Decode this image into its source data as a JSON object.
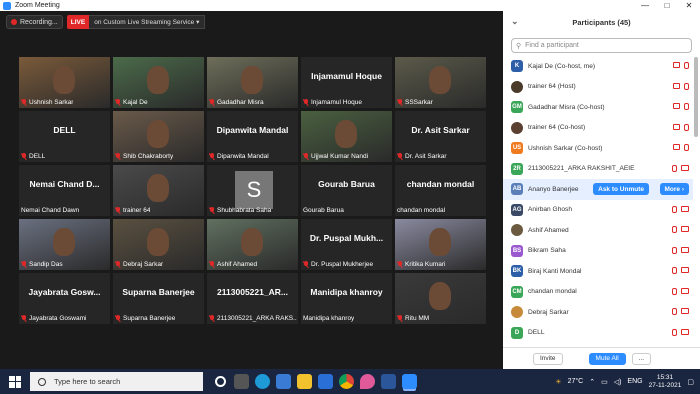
{
  "window": {
    "title": "Zoom Meeting",
    "min": "—",
    "max": "□",
    "close": "✕"
  },
  "topbar": {
    "recording": "Recording...",
    "live_tag": "LIVE",
    "live_service": "on Custom Live Streaming Service",
    "caret": "▾"
  },
  "tiles": [
    {
      "name": "Ushnish Sarkar",
      "big": "",
      "muted": true,
      "type": "video"
    },
    {
      "name": "Kajal De",
      "big": "",
      "muted": true,
      "type": "video"
    },
    {
      "name": "Gadadhar Misra",
      "big": "",
      "muted": true,
      "type": "video",
      "active": true
    },
    {
      "name": "Injamamul Hoque",
      "big": "Injamamul Hoque",
      "muted": true,
      "type": "name"
    },
    {
      "name": "SSSarkar",
      "big": "",
      "muted": true,
      "type": "video"
    },
    {
      "name": "DELL",
      "big": "DELL",
      "muted": true,
      "type": "name"
    },
    {
      "name": "Shib Chakraborty",
      "big": "",
      "muted": true,
      "type": "video"
    },
    {
      "name": "Dipanwita Mandal",
      "big": "Dipanwita Mandal",
      "muted": true,
      "type": "name"
    },
    {
      "name": "Ujjwal Kumar Nandi",
      "big": "",
      "muted": true,
      "type": "video"
    },
    {
      "name": "Dr. Asit Sarkar",
      "big": "Dr. Asit Sarkar",
      "muted": true,
      "type": "name"
    },
    {
      "name": "Nemai Chand Dawn",
      "big": "Nemai Chand D...",
      "muted": false,
      "type": "name"
    },
    {
      "name": "trainer 64",
      "big": "",
      "muted": true,
      "type": "video"
    },
    {
      "name": "Shubhabrata Saha",
      "big": "",
      "muted": true,
      "type": "avatar",
      "avatar": "S"
    },
    {
      "name": "Gourab Barua",
      "big": "Gourab Barua",
      "muted": false,
      "type": "name"
    },
    {
      "name": "chandan mondal",
      "big": "chandan mondal",
      "muted": false,
      "type": "name"
    },
    {
      "name": "Sandip Das",
      "big": "",
      "muted": true,
      "type": "video"
    },
    {
      "name": "Debraj Sarkar",
      "big": "",
      "muted": true,
      "type": "video"
    },
    {
      "name": "Ashif Ahamed",
      "big": "",
      "muted": true,
      "type": "video"
    },
    {
      "name": "Dr. Puspal Mukherjee",
      "big": "Dr. Puspal Mukh...",
      "muted": true,
      "type": "name"
    },
    {
      "name": "Kritika Kumari",
      "big": "",
      "muted": true,
      "type": "video"
    },
    {
      "name": "Jayabrata Goswami",
      "big": "Jayabrata Gosw...",
      "muted": true,
      "type": "name"
    },
    {
      "name": "Suparna Banerjee",
      "big": "Suparna Banerjee",
      "muted": true,
      "type": "name"
    },
    {
      "name": "2113005221_ARKA RAKS...",
      "big": "2113005221_AR...",
      "muted": true,
      "type": "name"
    },
    {
      "name": "Manidipa khanroy",
      "big": "Manidipa khanroy",
      "muted": false,
      "type": "name"
    },
    {
      "name": "Ritu MM",
      "big": "",
      "muted": true,
      "type": "video"
    }
  ],
  "participants": {
    "title": "Participants (45)",
    "search_placeholder": "Find a participant",
    "list": [
      {
        "label": "Kajal De (Co-host, me)",
        "avatar": "K",
        "color": "#2d5fa8",
        "photo": false
      },
      {
        "label": "trainer 64 (Host)",
        "avatar": "",
        "color": "#4a3a2a",
        "photo": true
      },
      {
        "label": "Gadadhar Misra (Co-host)",
        "avatar": "GM",
        "color": "#3aa657",
        "photo": false
      },
      {
        "label": "trainer 64 (Co-host)",
        "avatar": "",
        "color": "#5a4030",
        "photo": true
      },
      {
        "label": "Ushnish Sarkar (Co-host)",
        "avatar": "US",
        "color": "#f07a1e",
        "photo": false
      },
      {
        "label": "2113005221_ARKA RAKSHIT_AEIE",
        "avatar": "2R",
        "color": "#3aa657",
        "photo": false
      },
      {
        "label": "Ananyo Banerjee",
        "avatar": "AB",
        "color": "#5b7fb8",
        "photo": false,
        "highlight": true
      },
      {
        "label": "Anirban Ghosh",
        "avatar": "AG",
        "color": "#3a4a66",
        "photo": false
      },
      {
        "label": "Ashif Ahamed",
        "avatar": "",
        "color": "#6b5a40",
        "photo": true
      },
      {
        "label": "Bikram Saha",
        "avatar": "BS",
        "color": "#9b59d0",
        "photo": false
      },
      {
        "label": "Biraj Kanti Mondal",
        "avatar": "BK",
        "color": "#2d5fa8",
        "photo": false
      },
      {
        "label": "chandan mondal",
        "avatar": "CM",
        "color": "#3aa657",
        "photo": false
      },
      {
        "label": "Debraj Sarkar",
        "avatar": "",
        "color": "#c78a3a",
        "photo": true
      },
      {
        "label": "DELL",
        "avatar": "D",
        "color": "#3aa657",
        "photo": false
      }
    ],
    "ask_to_unmute": "Ask to Unmute",
    "more": "More ›",
    "invite": "Invite",
    "mute_all": "Mute All",
    "ellipsis": "..."
  },
  "taskbar": {
    "search": "Type here to search",
    "temp": "27°C",
    "lang": "ENG",
    "time": "15:31",
    "date": "27-11-2021"
  }
}
